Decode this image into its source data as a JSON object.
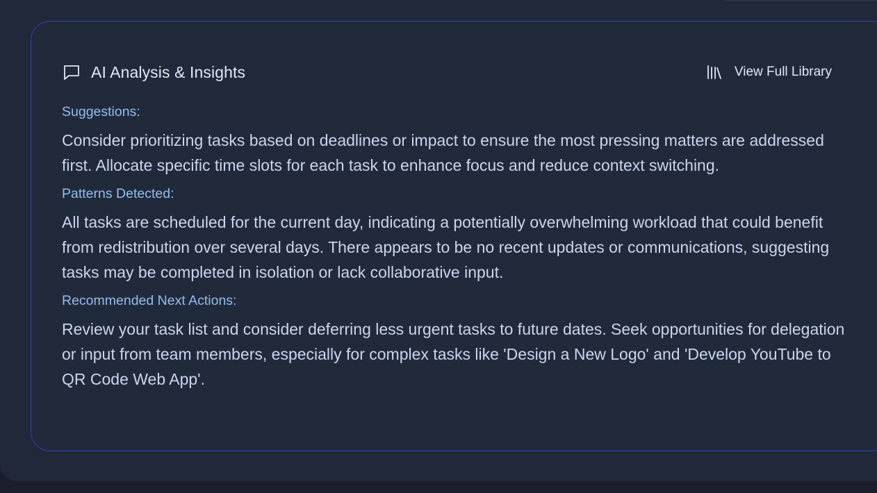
{
  "card": {
    "title": "AI Analysis & Insights",
    "chat_icon": "chat-bubble-icon",
    "library_icon": "library-books-icon",
    "library_button_label": "View Full Library"
  },
  "sections": [
    {
      "label": "Suggestions:",
      "body": "Consider prioritizing tasks based on deadlines or impact to ensure the most pressing matters are addressed first. Allocate specific time slots for each task to enhance focus and reduce context switching."
    },
    {
      "label": "Patterns Detected:",
      "body": "All tasks are scheduled for the current day, indicating a potentially overwhelming workload that could benefit from redistribution over several days. There appears to be no recent updates or communications, suggesting tasks may be completed in isolation or lack collaborative input."
    },
    {
      "label": "Recommended Next Actions:",
      "body": "Review your task list and consider deferring less urgent tasks to future dates. Seek opportunities for delegation or input from team members, especially for complex tasks like 'Design a New Logo' and 'Develop YouTube to QR Code Web App'."
    }
  ],
  "colors": {
    "page_background": "#1a1e2a",
    "panel_background": "#20283a",
    "card_background": "#212a3b",
    "card_border": "#2f45a8",
    "label_color": "#93bdf0",
    "body_text": "#cad6ee",
    "title_text": "#e3e8f2"
  }
}
